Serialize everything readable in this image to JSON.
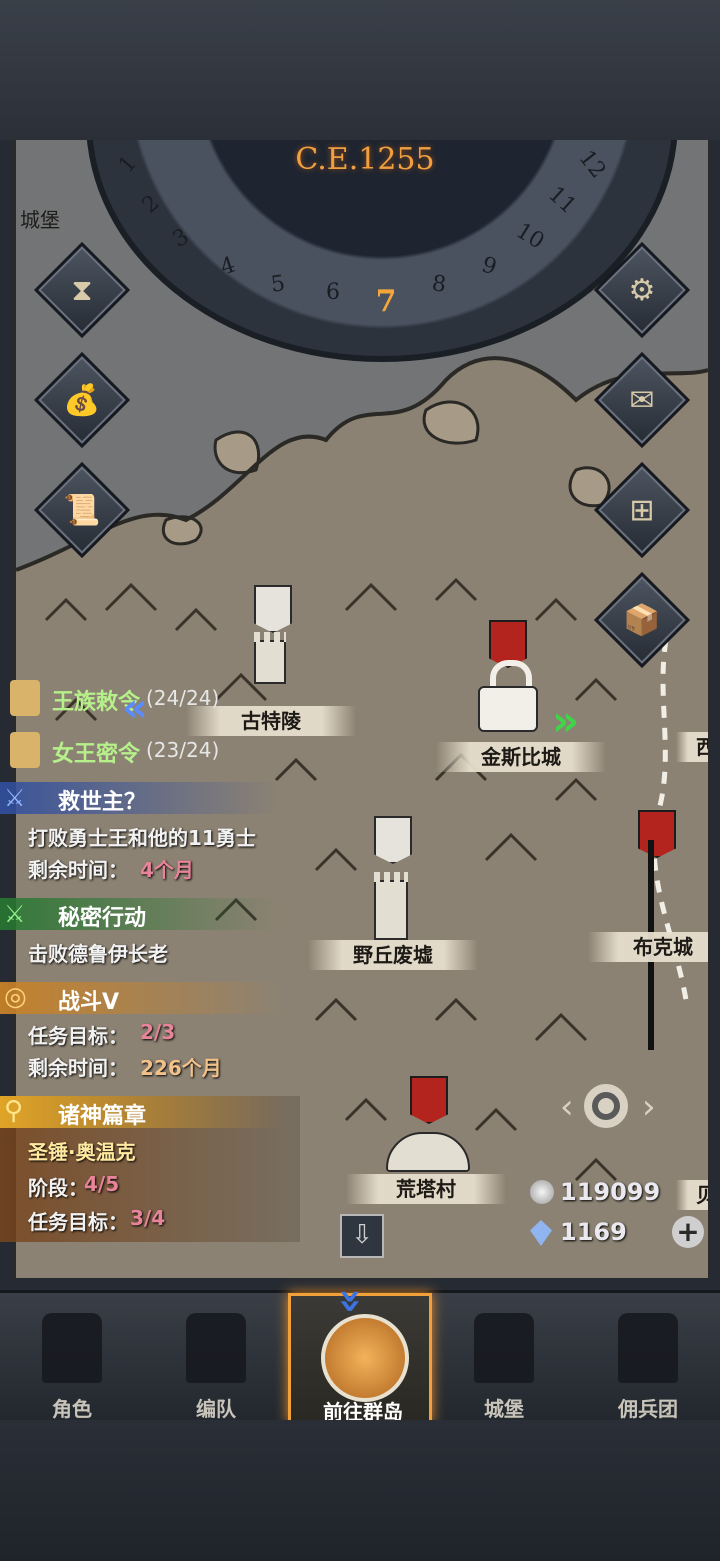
{
  "calendar": {
    "era": "C.E.1255",
    "current_month": "7",
    "months": [
      "1",
      "2",
      "3",
      "4",
      "5",
      "6",
      "8",
      "9",
      "10",
      "11",
      "12"
    ]
  },
  "left_buttons": [
    {
      "name": "hourglass-icon",
      "glyph": "⧗"
    },
    {
      "name": "money-bag-icon",
      "glyph": "💰"
    },
    {
      "name": "scroll-icon",
      "glyph": "📜"
    }
  ],
  "right_buttons": [
    {
      "name": "settings-gear-icon",
      "glyph": "⚙"
    },
    {
      "name": "mail-envelope-icon",
      "glyph": "✉"
    },
    {
      "name": "map-grid-icon",
      "glyph": "⊞"
    },
    {
      "name": "supplies-crate-icon",
      "glyph": "📦"
    }
  ],
  "map": {
    "corner_label": "城堡",
    "locations": [
      {
        "id": "gutling",
        "label": "古特陵"
      },
      {
        "id": "jinsibi",
        "label": "金斯比城"
      },
      {
        "id": "yeqiu",
        "label": "野丘废墟"
      },
      {
        "id": "buke",
        "label": "布克城"
      },
      {
        "id": "huangta",
        "label": "荒塔村"
      },
      {
        "id": "xi",
        "label": "西"
      },
      {
        "id": "bei",
        "label": "贝"
      }
    ]
  },
  "quests": {
    "royal_edict": {
      "title": "王族敕令",
      "progress": "(24/24)"
    },
    "queen_order": {
      "title": "女王密令",
      "progress": "(23/24)"
    },
    "savior": {
      "title": "救世主？",
      "desc": "打败勇士王和他的11勇士",
      "time_label": "剩余时间：",
      "time_value": "4个月"
    },
    "secret": {
      "title": "秘密行动",
      "desc": "击败德鲁伊长老"
    },
    "battle": {
      "title": "战斗V",
      "goal_label": "任务目标：",
      "goal_value": "2/3",
      "time_label": "剩余时间：",
      "time_value": "226个月"
    },
    "gods": {
      "title": "诸神篇章",
      "name": "圣锤·奥温克",
      "stage_label": "阶段：",
      "stage_value": "4/5",
      "goal_label": "任务目标：",
      "goal_value": "3/4"
    }
  },
  "resources": {
    "silver": "119099",
    "crystals": "1169"
  },
  "bottom_nav": [
    {
      "id": "character",
      "label": "角色"
    },
    {
      "id": "formation",
      "label": "编队"
    },
    {
      "id": "islands",
      "label": "前往群岛"
    },
    {
      "id": "castle",
      "label": "城堡"
    },
    {
      "id": "mercenary",
      "label": "佣兵团"
    }
  ],
  "colors": {
    "accent_orange": "#f1a13a",
    "quest_red": "#e7849a",
    "quest_green": "#b6f08a",
    "map_parchment": "#8c8273"
  }
}
